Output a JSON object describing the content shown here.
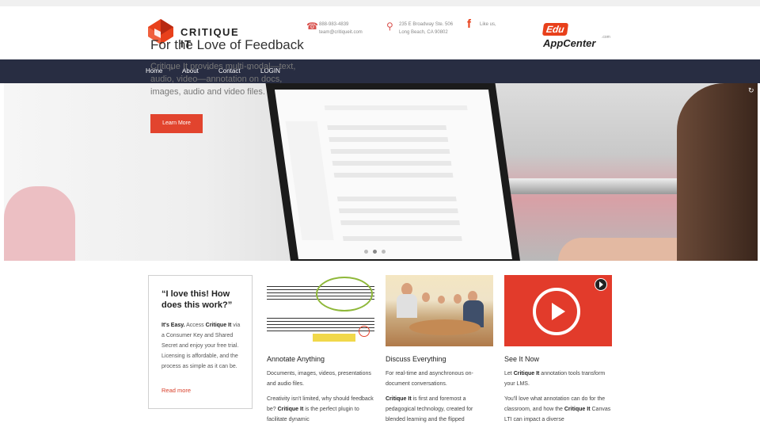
{
  "header": {
    "brand": "CRITIQUE IT",
    "phone": "888-983-4839",
    "email": "team@critiqueit.com",
    "address_line1": "235 E Broadway Ste. 506",
    "address_line2": "Long Beach, CA 90802",
    "like_us": "Like us,",
    "edu": "Edu",
    "appcenter": "AppCenter",
    "dotcom": ".com"
  },
  "nav": {
    "items": [
      {
        "label": "Home"
      },
      {
        "label": "About"
      },
      {
        "label": "Contact"
      },
      {
        "label": "LOGIN"
      }
    ],
    "separator": "×"
  },
  "hero": {
    "title": "For the Love of Feedback",
    "description": "Critique It provides multi-modal—text, audio, video—annotation on docs, images, audio and video files.",
    "button": "Learn More"
  },
  "quote_box": {
    "quote": "“I love this! How does this work?”",
    "lead": "It's Easy.",
    "body_prefix": " Access ",
    "brand": "Critique It",
    "body_suffix": " via a Consumer Key and Shared Secret and enjoy your free trial. Licensing is affordable, and the process as simple as it can be.",
    "read_more": "Read more"
  },
  "cards": [
    {
      "title": "Annotate Anything",
      "p1": "Documents, images, videos, presentations and audio files.",
      "p2_prefix": "Creativity isn't limited, why should feedback be? ",
      "p2_brand": "Critique It",
      "p2_suffix": " is the perfect plugin to facilitate dynamic"
    },
    {
      "title": "Discuss Everything",
      "p1": "For real-time and asynchronous on-document conversations.",
      "p2_brand": "Critique It",
      "p2_suffix": " is first and foremost a pedagogical technology, created for blended learning and the flipped"
    },
    {
      "title": "See It Now",
      "p1_prefix": "Let ",
      "p1_brand": "Critique It",
      "p1_suffix": " annotation tools transform your LMS.",
      "p2_prefix": "You'll love what annotation can do for the classroom, and how the ",
      "p2_brand": "Critique It",
      "p2_suffix": " Canvas LTI can impact a diverse"
    }
  ],
  "colors": {
    "nav_bg": "#282d42",
    "accent_red": "#e2442e",
    "brand_red": "#d9402b"
  }
}
